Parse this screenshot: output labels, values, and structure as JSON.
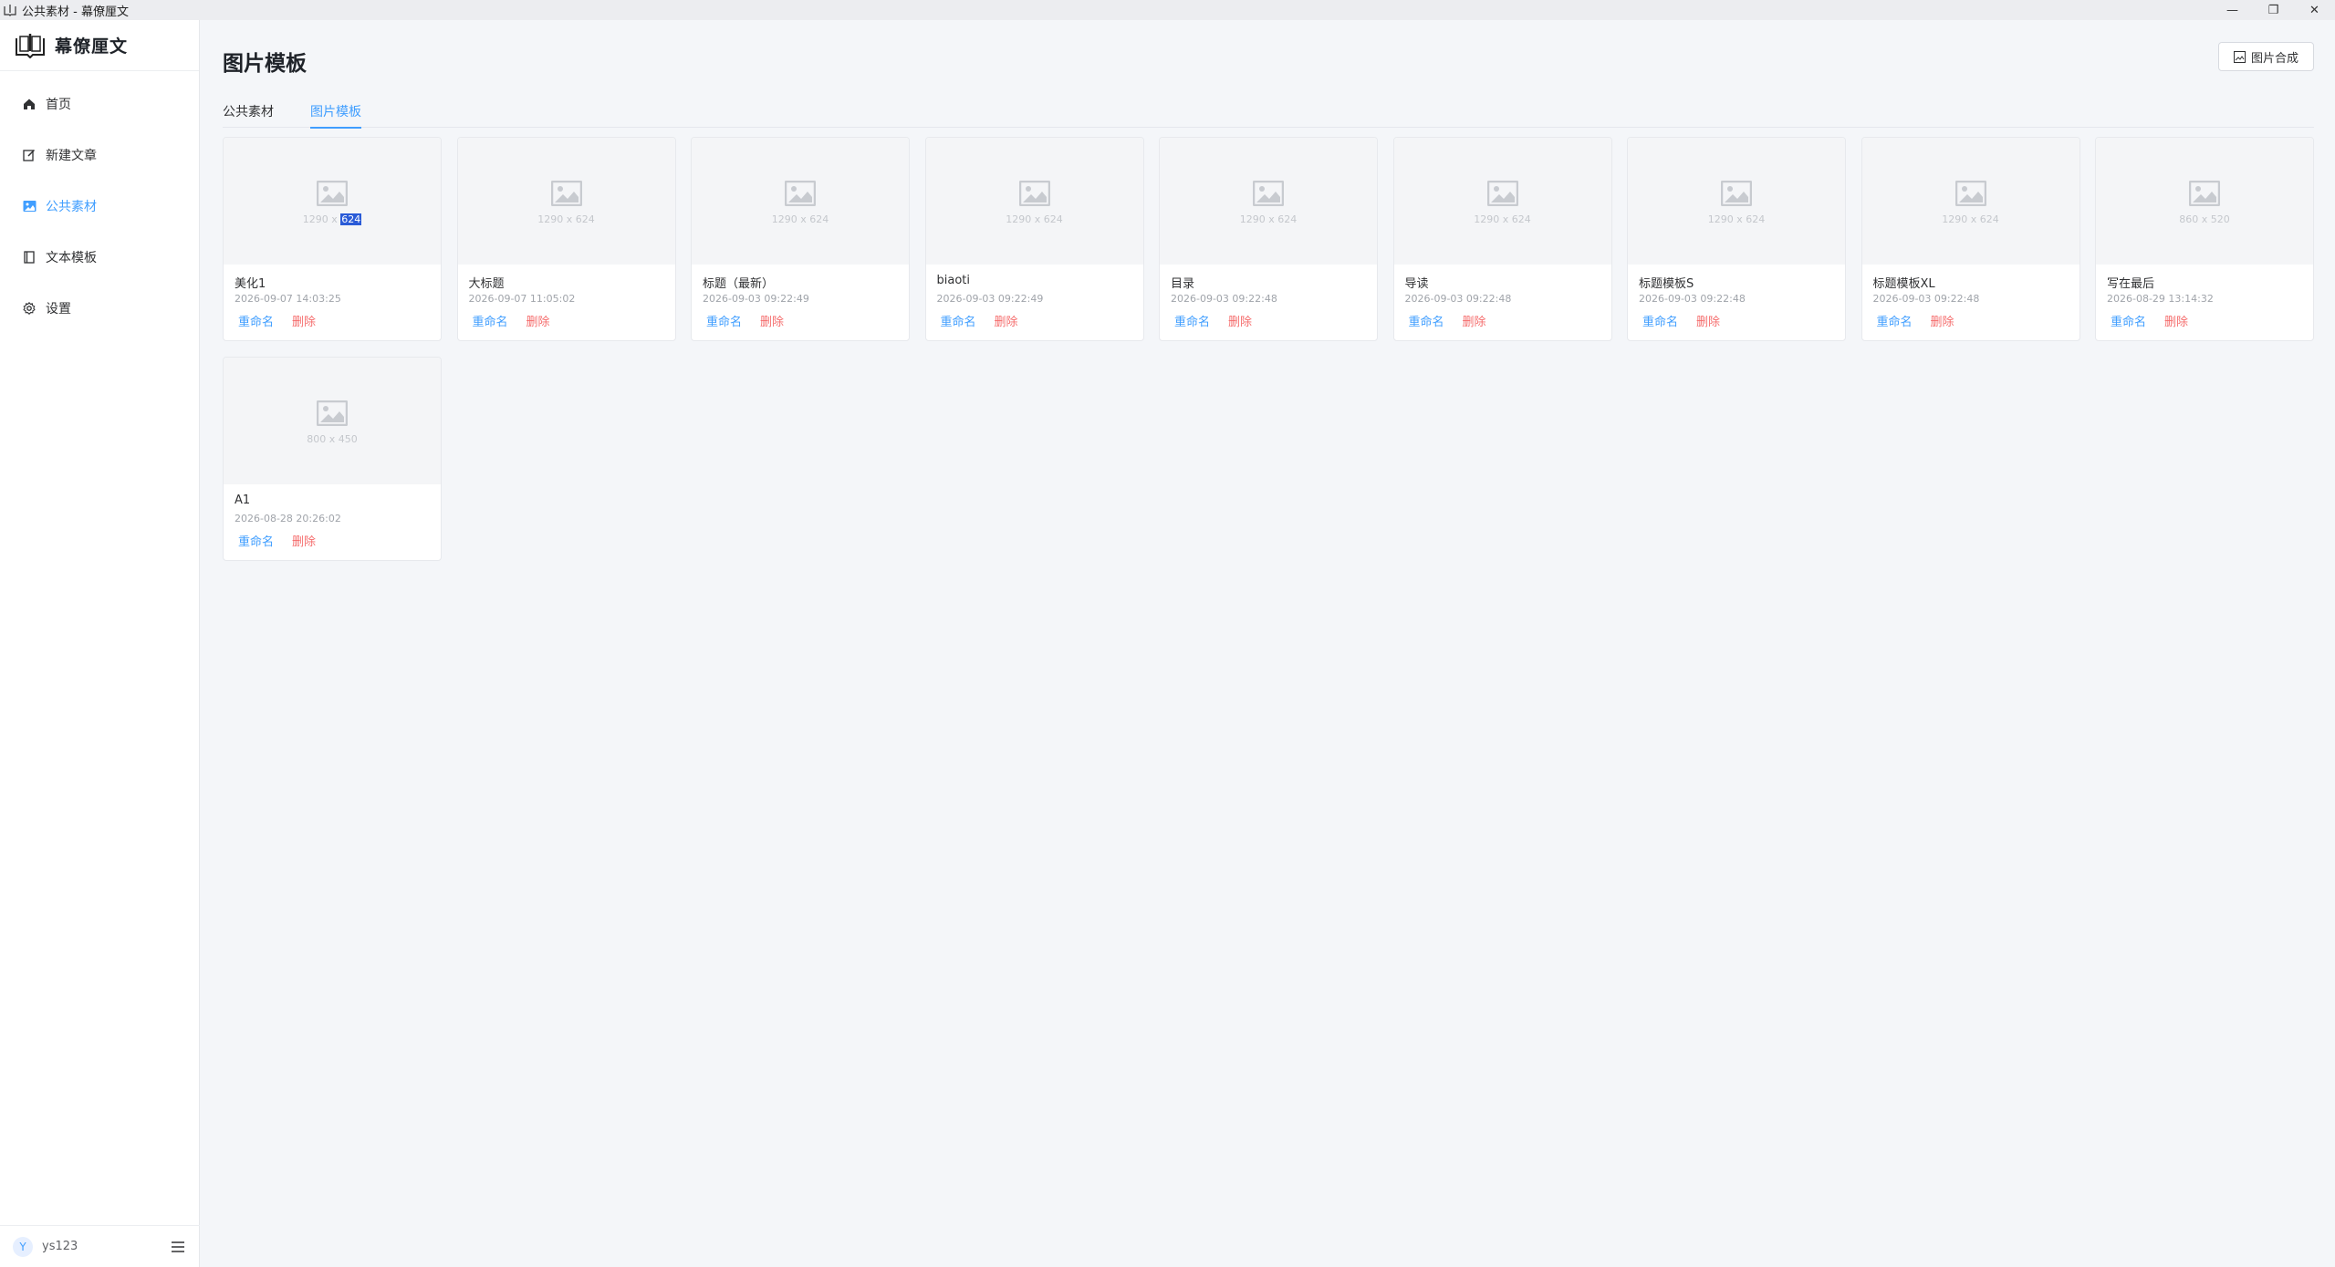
{
  "window": {
    "title": "公共素材 - 幕僚厘文",
    "controls": {
      "minimize": "—",
      "restore": "❐",
      "close": "✕"
    }
  },
  "sidebar": {
    "brand": "幕僚厘文",
    "items": [
      {
        "label": "首页",
        "icon": "home-icon",
        "active": false
      },
      {
        "label": "新建文章",
        "icon": "edit-icon",
        "active": false
      },
      {
        "label": "公共素材",
        "icon": "image-icon",
        "active": true
      },
      {
        "label": "文本模板",
        "icon": "book-icon",
        "active": false
      },
      {
        "label": "设置",
        "icon": "gear-icon",
        "active": false
      }
    ],
    "user": {
      "avatar_letter": "Y",
      "name": "ys123"
    }
  },
  "header": {
    "title": "图片模板",
    "compose_button": "图片合成"
  },
  "tabs": [
    {
      "label": "公共素材",
      "active": false
    },
    {
      "label": "图片模板",
      "active": true
    }
  ],
  "cards": [
    {
      "name": "美化1",
      "dims_prefix": "1290 x ",
      "dims_suffix": "624",
      "time": "2026-09-07 14:03:25",
      "rename": "重命名",
      "delete": "删除"
    },
    {
      "name": "大标题",
      "dims": "1290 x 624",
      "time": "2026-09-07 11:05:02",
      "rename": "重命名",
      "delete": "删除"
    },
    {
      "name": "标题（最新）",
      "dims": "1290 x 624",
      "time": "2026-09-03 09:22:49",
      "rename": "重命名",
      "delete": "删除"
    },
    {
      "name": "biaoti",
      "dims": "1290 x 624",
      "time": "2026-09-03 09:22:49",
      "rename": "重命名",
      "delete": "删除"
    },
    {
      "name": "目录",
      "dims": "1290 x 624",
      "time": "2026-09-03 09:22:48",
      "rename": "重命名",
      "delete": "删除"
    },
    {
      "name": "导读",
      "dims": "1290 x 624",
      "time": "2026-09-03 09:22:48",
      "rename": "重命名",
      "delete": "删除"
    },
    {
      "name": "标题模板S",
      "dims": "1290 x 624",
      "time": "2026-09-03 09:22:48",
      "rename": "重命名",
      "delete": "删除"
    },
    {
      "name": "标题模板XL",
      "dims": "1290 x 624",
      "time": "2026-09-03 09:22:48",
      "rename": "重命名",
      "delete": "删除"
    },
    {
      "name": "写在最后",
      "dims": "860 x 520",
      "time": "2026-08-29 13:14:32",
      "rename": "重命名",
      "delete": "删除"
    },
    {
      "name": "A1",
      "dims": "800 x 450",
      "time": "2026-08-28 20:26:02",
      "rename": "重命名",
      "delete": "删除"
    }
  ],
  "colors": {
    "accent": "#409eff",
    "danger": "#f56c6c",
    "background": "#f4f6f9"
  }
}
